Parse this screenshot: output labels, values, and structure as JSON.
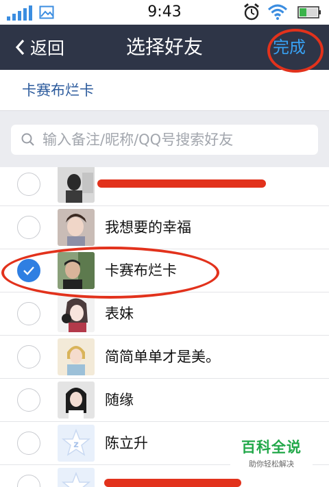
{
  "status_bar": {
    "time": "9:43",
    "icons": [
      "signal-bars-icon",
      "image-icon",
      "alarm-clock-icon",
      "wifi-icon",
      "battery-icon"
    ]
  },
  "nav": {
    "back_label": "返回",
    "title": "选择好友",
    "done_label": "完成"
  },
  "selected_strip": {
    "names": [
      "卡赛布烂卡"
    ]
  },
  "search": {
    "placeholder": "输入备注/昵称/QQ号搜索好友"
  },
  "friends": [
    {
      "name": "",
      "checked": false,
      "redacted": true
    },
    {
      "name": "我想要的幸福",
      "checked": false
    },
    {
      "name": "卡赛布烂卡",
      "checked": true
    },
    {
      "name": "表妹",
      "checked": false
    },
    {
      "name": "简简单单才是美。",
      "checked": false
    },
    {
      "name": "随缘",
      "checked": false
    },
    {
      "name": "陈立升",
      "checked": false
    },
    {
      "name": "",
      "checked": false,
      "redacted": true
    }
  ],
  "watermark": {
    "title": "百科全说",
    "subtitle": "助你轻松解决"
  },
  "colors": {
    "nav_bg": "#2e3547",
    "done_blue": "#38a1f3",
    "check_blue": "#2f7fe2",
    "annotation_red": "#e2321c",
    "watermark_green": "#22a84a"
  }
}
